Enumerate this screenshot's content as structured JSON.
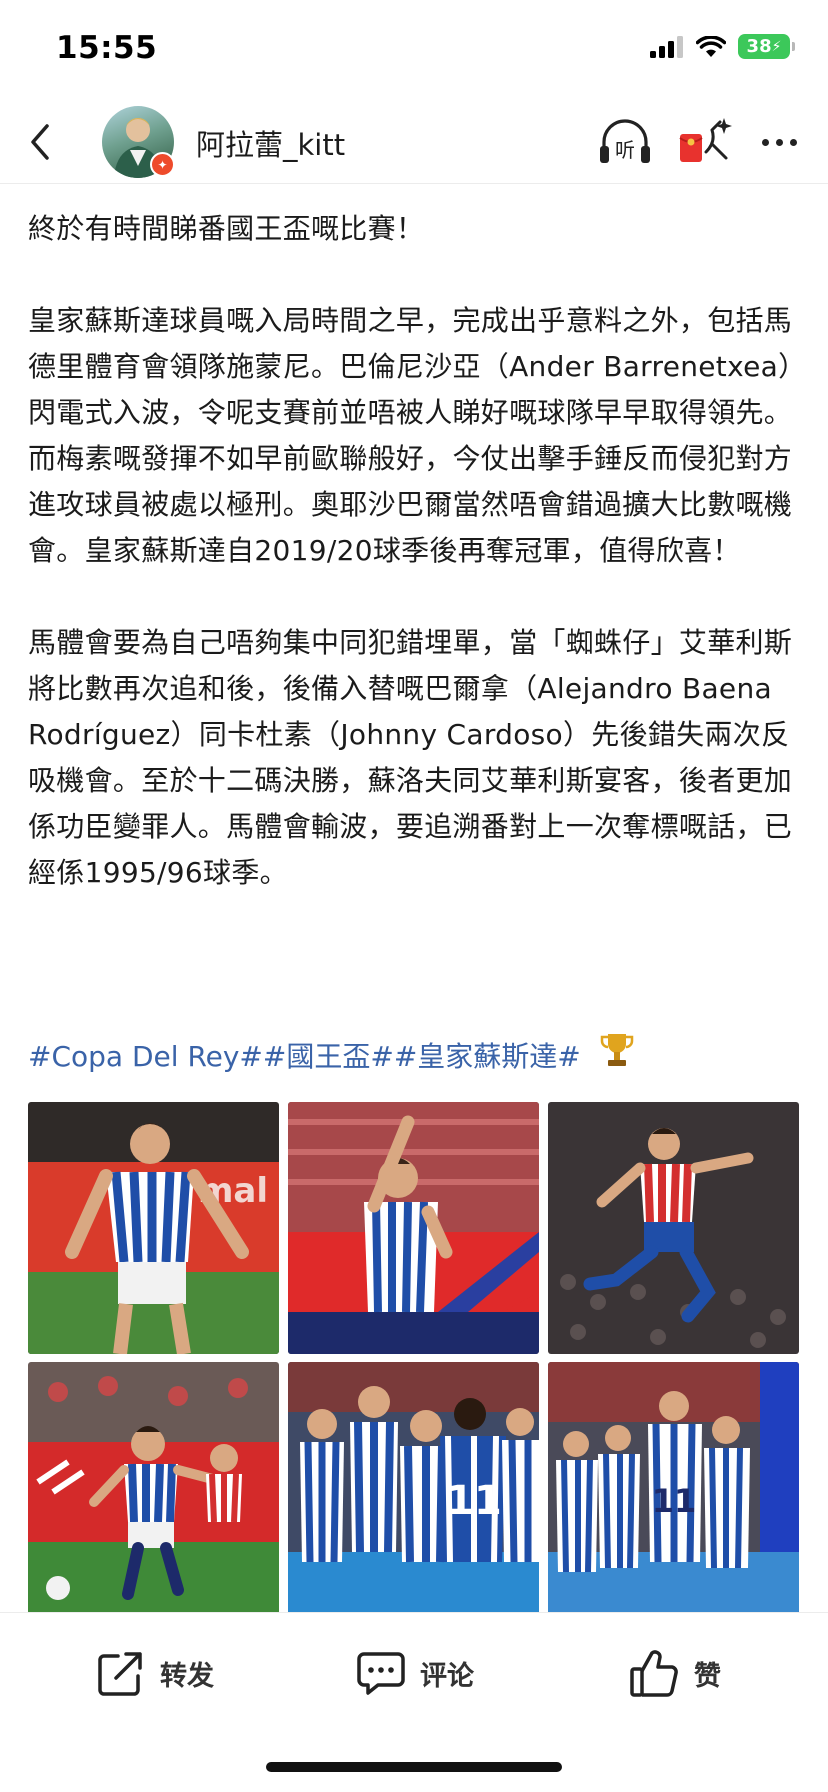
{
  "status_bar": {
    "time": "15:55",
    "battery": "38"
  },
  "header": {
    "username": "阿拉蕾_kitt",
    "back_icon": "chevron-left-icon",
    "listen_label": "听",
    "listen_icon": "headphones-icon",
    "redpacket_icon": "red-envelope-icon",
    "more_icon": "more-dots-icon"
  },
  "post": {
    "paragraphs": [
      "終於有時間睇番國王盃嘅比賽！",
      "皇家蘇斯達球員嘅入局時間之早，完成出乎意料之外，包括馬德里體育會領隊施蒙尼。巴倫尼沙亞（Ander Barrenetxea）閃電式入波，令呢支賽前並唔被人睇好嘅球隊早早取得領先。而梅素嘅發揮不如早前歐聯般好，今仗出擊手錘反而侵犯對方進攻球員被處以極刑。奧耶沙巴爾當然唔會錯過擴大比數嘅機會。皇家蘇斯達自2019/20球季後再奪冠軍，值得欣喜！",
      "馬體會要為自己唔夠集中同犯錯埋單，當「蜘蛛仔」艾華利斯將比數再次追和後，後備入替嘅巴爾拿（Alejandro Baena Rodríguez）同卡杜素（Johnny Cardoso）先後錯失兩次反吸機會。至於十二碼決勝，蘇洛夫同艾華利斯宴客，後者更加係功臣變罪人。馬體會輸波，要追溯番對上一次奪標嘅話，已經係1995/96球季。"
    ],
    "hashtags": "#Copa Del Rey##國王盃##皇家蘇斯達#",
    "hashtags_icon": "trophy-icon",
    "photos": [
      {
        "name": "photo-1",
        "icon": "player-celebrating-photo"
      },
      {
        "name": "photo-2",
        "icon": "player-pointing-photo"
      },
      {
        "name": "photo-3",
        "icon": "player-jumping-photo"
      },
      {
        "name": "photo-4",
        "icon": "player-running-photo"
      },
      {
        "name": "photo-5",
        "icon": "team-celebration-photo"
      },
      {
        "name": "photo-6",
        "icon": "team-huddle-photo"
      }
    ]
  },
  "actions": {
    "repost": "转发",
    "comment": "评论",
    "like": "赞"
  },
  "colors": {
    "hashtag": "#3a63a8",
    "battery": "#3cc85a",
    "real_sociedad_blue": "#1f4ea8",
    "atletico_red": "#d32f2f"
  }
}
